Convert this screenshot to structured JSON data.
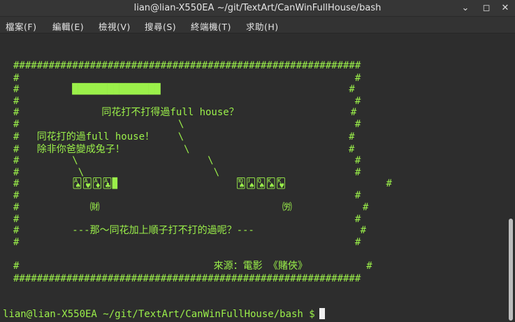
{
  "window": {
    "title": "lian@lian-X550EA ~/git/TextArt/CanWinFullHouse/bash",
    "buttons": {
      "minimize": "⌄",
      "restore": "◻",
      "close": "✕"
    }
  },
  "menu": [
    "檔案(F)",
    "編輯(E)",
    "檢視(V)",
    "搜尋(S)",
    "終端機(T)",
    "求助(H)"
  ],
  "terminal": {
    "lines": [
      "###########################################################",
      "#                                                         #",
      "#         ███████████████                                #",
      "#                                                         #",
      "#              同花打不打得過full house？                   #",
      "#                           \\                             #",
      "#   同花打的過full house！    \\                            #",
      "#   除非你爸變成兔子！          \\                           #",
      "#         \\                      \\                        #",
      "#          \\                      \\                       #",
      "#         🂡🂱🃁🃑▉                    🂪🂫🂭🂮🂾                 #",
      "#                                                         #",
      "#            ㈶                               ㈸            #",
      "#                                                         #",
      "#         ---那～同花加上順子打不打的過呢？---                  #",
      "#                                                         #",
      "#                                 來源：電影 《賭俠》          #",
      "###########################################################"
    ],
    "prompt": "lian@lian-X550EA ~/git/TextArt/CanWinFullHouse/bash $"
  }
}
